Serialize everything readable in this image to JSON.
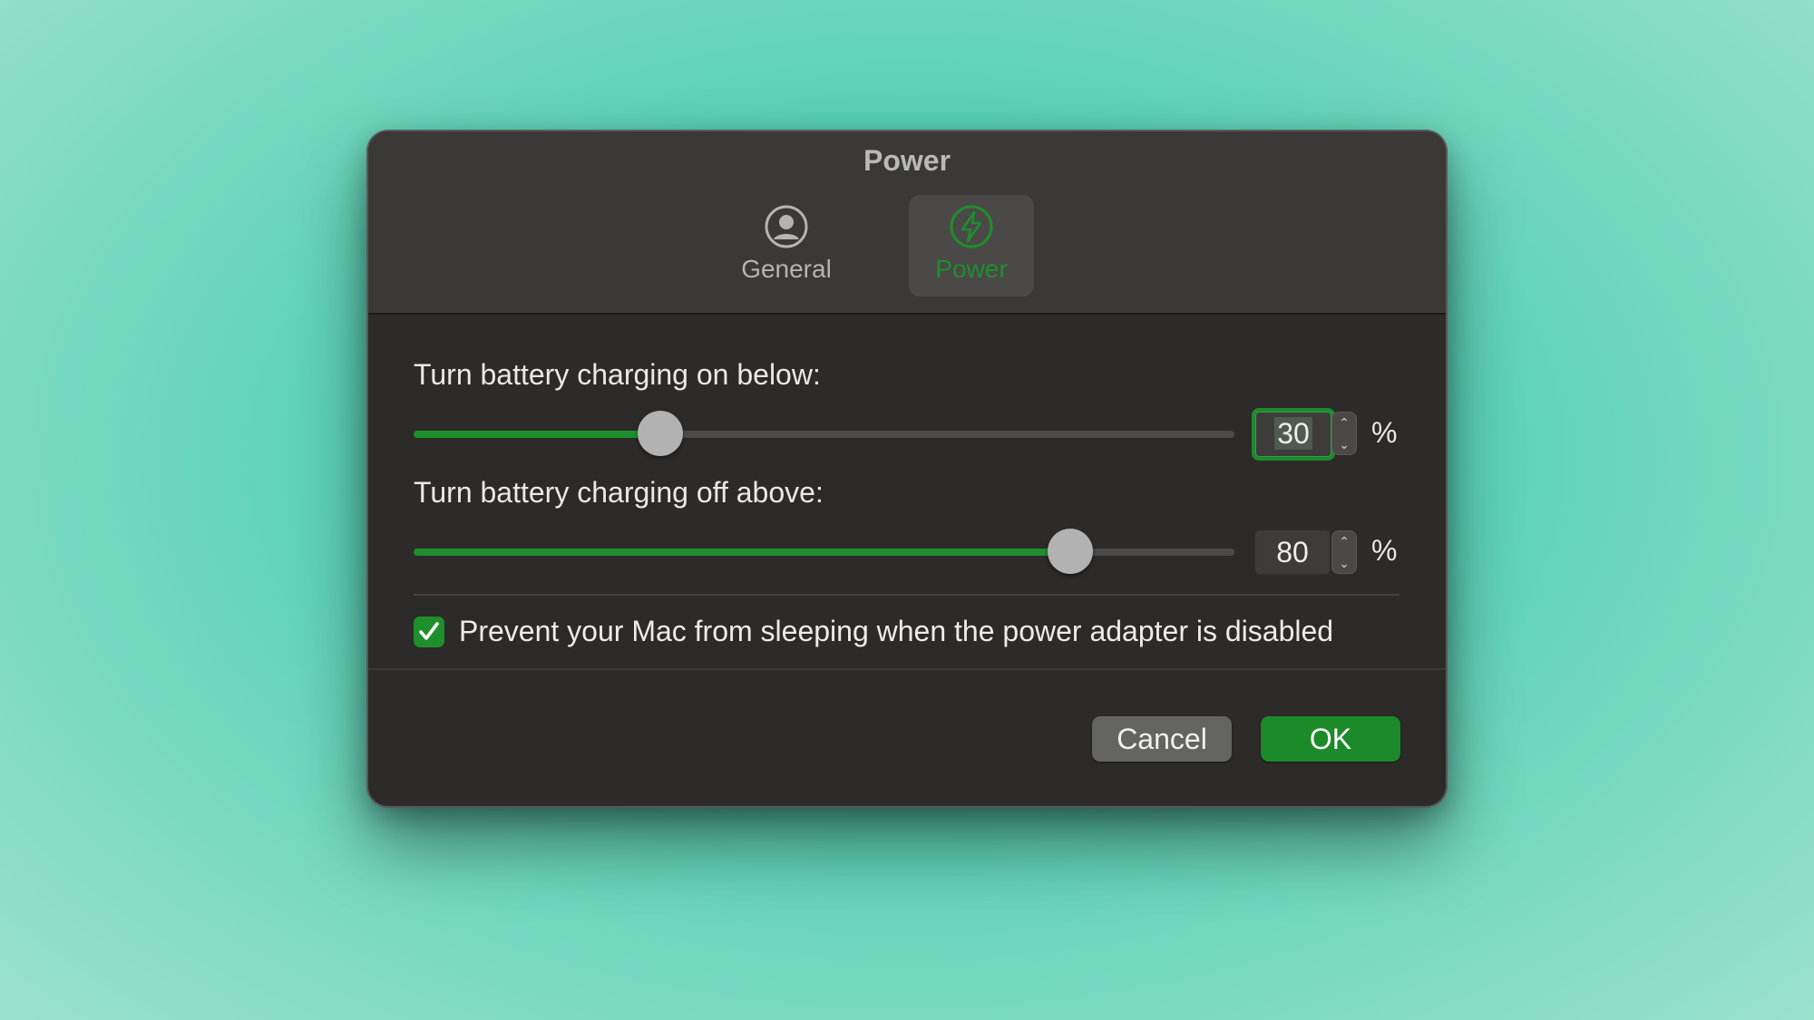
{
  "window": {
    "title": "Power"
  },
  "tabs": [
    {
      "label": "General",
      "icon": "person-circle-icon",
      "selected": false
    },
    {
      "label": "Power",
      "icon": "bolt-circle-icon",
      "selected": true
    }
  ],
  "charge_on": {
    "label": "Turn battery charging on below:",
    "value": "30",
    "fraction": 0.3,
    "unit": "%"
  },
  "charge_off": {
    "label": "Turn battery charging off above:",
    "value": "80",
    "fraction": 0.8,
    "unit": "%"
  },
  "prevent_sleep": {
    "label": "Prevent your Mac from sleeping when the power adapter is disabled",
    "checked": true
  },
  "buttons": {
    "cancel": "Cancel",
    "ok": "OK"
  },
  "colors": {
    "accent": "#1e8f2c",
    "window_bg": "#2c2b29",
    "titlebar_bg": "#3a3938",
    "background": "#5ad2b5"
  }
}
